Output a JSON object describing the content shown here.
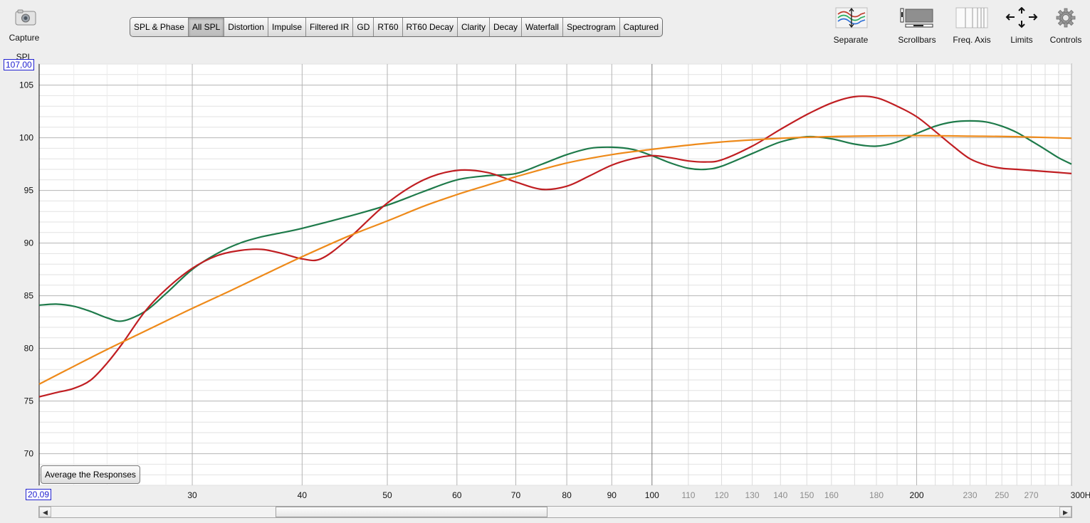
{
  "toolbar": {
    "capture_label": "Capture",
    "separate_label": "Separate",
    "scrollbars_label": "Scrollbars",
    "freq_axis_label": "Freq. Axis",
    "limits_label": "Limits",
    "controls_label": "Controls"
  },
  "tabs": [
    {
      "label": "SPL & Phase",
      "active": false
    },
    {
      "label": "All SPL",
      "active": true
    },
    {
      "label": "Distortion",
      "active": false
    },
    {
      "label": "Impulse",
      "active": false
    },
    {
      "label": "Filtered IR",
      "active": false
    },
    {
      "label": "GD",
      "active": false
    },
    {
      "label": "RT60",
      "active": false
    },
    {
      "label": "RT60 Decay",
      "active": false
    },
    {
      "label": "Clarity",
      "active": false
    },
    {
      "label": "Decay",
      "active": false
    },
    {
      "label": "Waterfall",
      "active": false
    },
    {
      "label": "Spectrogram",
      "active": false
    },
    {
      "label": "Captured",
      "active": false
    }
  ],
  "graph": {
    "y_axis_label": "SPL",
    "y_max_box": "107,00",
    "x_min_box": "20,09",
    "average_button": "Average the Responses"
  },
  "colors": {
    "series_green": "#1e7a4a",
    "series_red": "#c01e22",
    "series_orange": "#ee8a1a",
    "axis_box": "#2020d0",
    "plot_bg": "#ffffff"
  },
  "chart_data": {
    "type": "line",
    "xscale": "log",
    "xlim": [
      20.09,
      300
    ],
    "ylim": [
      67,
      107
    ],
    "xlabel": "Hz",
    "ylabel": "SPL",
    "y_ticks": [
      70,
      75,
      80,
      85,
      90,
      95,
      100,
      105
    ],
    "x_ticks_major": [
      {
        "v": 30,
        "label": "30"
      },
      {
        "v": 40,
        "label": "40"
      },
      {
        "v": 50,
        "label": "50"
      },
      {
        "v": 60,
        "label": "60"
      },
      {
        "v": 70,
        "label": "70"
      },
      {
        "v": 80,
        "label": "80"
      },
      {
        "v": 90,
        "label": "90"
      },
      {
        "v": 100,
        "label": "100"
      },
      {
        "v": 200,
        "label": "200"
      },
      {
        "v": 300,
        "label": "300Hz"
      }
    ],
    "x_ticks_minor": [
      {
        "v": 110,
        "label": "110"
      },
      {
        "v": 120,
        "label": "120"
      },
      {
        "v": 130,
        "label": "130"
      },
      {
        "v": 140,
        "label": "140"
      },
      {
        "v": 150,
        "label": "150"
      },
      {
        "v": 160,
        "label": "160"
      },
      {
        "v": 180,
        "label": "180"
      },
      {
        "v": 230,
        "label": "230"
      },
      {
        "v": 250,
        "label": "250"
      },
      {
        "v": 270,
        "label": "270"
      }
    ],
    "series": [
      {
        "color": "#1e7a4a",
        "x": [
          20.09,
          21,
          22,
          23,
          24,
          25,
          26.5,
          28,
          30,
          32,
          34,
          36,
          38,
          40,
          45,
          50,
          55,
          60,
          65,
          70,
          75,
          80,
          85,
          90,
          95,
          100,
          105,
          110,
          115,
          120,
          130,
          140,
          150,
          160,
          170,
          180,
          190,
          200,
          210,
          220,
          230,
          240,
          250,
          260,
          270,
          280,
          290,
          300
        ],
        "y": [
          84.1,
          84.2,
          84.0,
          83.5,
          82.9,
          82.6,
          83.5,
          85.2,
          87.5,
          89.0,
          90.0,
          90.6,
          91.0,
          91.4,
          92.5,
          93.6,
          94.9,
          96.0,
          96.4,
          96.6,
          97.5,
          98.4,
          99.0,
          99.1,
          98.9,
          98.3,
          97.6,
          97.1,
          97.0,
          97.3,
          98.5,
          99.6,
          100.1,
          99.9,
          99.4,
          99.2,
          99.6,
          100.4,
          101.1,
          101.5,
          101.6,
          101.5,
          101.1,
          100.5,
          99.7,
          98.9,
          98.1,
          97.5
        ]
      },
      {
        "color": "#c01e22",
        "x": [
          20.09,
          21,
          22,
          23,
          24,
          25,
          26.5,
          28,
          30,
          32,
          34,
          36,
          38,
          40,
          42,
          45,
          50,
          55,
          60,
          65,
          70,
          75,
          80,
          85,
          90,
          95,
          100,
          105,
          110,
          115,
          120,
          130,
          140,
          150,
          160,
          170,
          180,
          190,
          200,
          210,
          220,
          230,
          240,
          250,
          260,
          270,
          280,
          290,
          300
        ],
        "y": [
          75.4,
          75.8,
          76.2,
          77.0,
          78.6,
          80.5,
          83.5,
          85.6,
          87.6,
          88.8,
          89.3,
          89.4,
          89.0,
          88.5,
          88.5,
          90.3,
          93.8,
          96.0,
          96.9,
          96.7,
          95.8,
          95.1,
          95.4,
          96.4,
          97.4,
          98.0,
          98.3,
          98.1,
          97.8,
          97.7,
          97.9,
          99.2,
          100.8,
          102.2,
          103.3,
          103.9,
          103.8,
          103.0,
          102.0,
          100.6,
          99.2,
          98.0,
          97.4,
          97.1,
          97.0,
          96.9,
          96.8,
          96.7,
          96.6
        ]
      },
      {
        "color": "#ee8a1a",
        "x": [
          20.09,
          22,
          24,
          26,
          28,
          30,
          33,
          36,
          40,
          45,
          50,
          55,
          60,
          65,
          70,
          80,
          90,
          100,
          110,
          120,
          130,
          140,
          150,
          170,
          200,
          230,
          260,
          300
        ],
        "y": [
          76.6,
          78.3,
          79.9,
          81.3,
          82.6,
          83.8,
          85.4,
          86.9,
          88.7,
          90.6,
          92.1,
          93.5,
          94.6,
          95.5,
          96.3,
          97.6,
          98.4,
          98.9,
          99.3,
          99.6,
          99.8,
          99.95,
          100.05,
          100.15,
          100.2,
          100.15,
          100.1,
          99.95
        ]
      }
    ]
  }
}
